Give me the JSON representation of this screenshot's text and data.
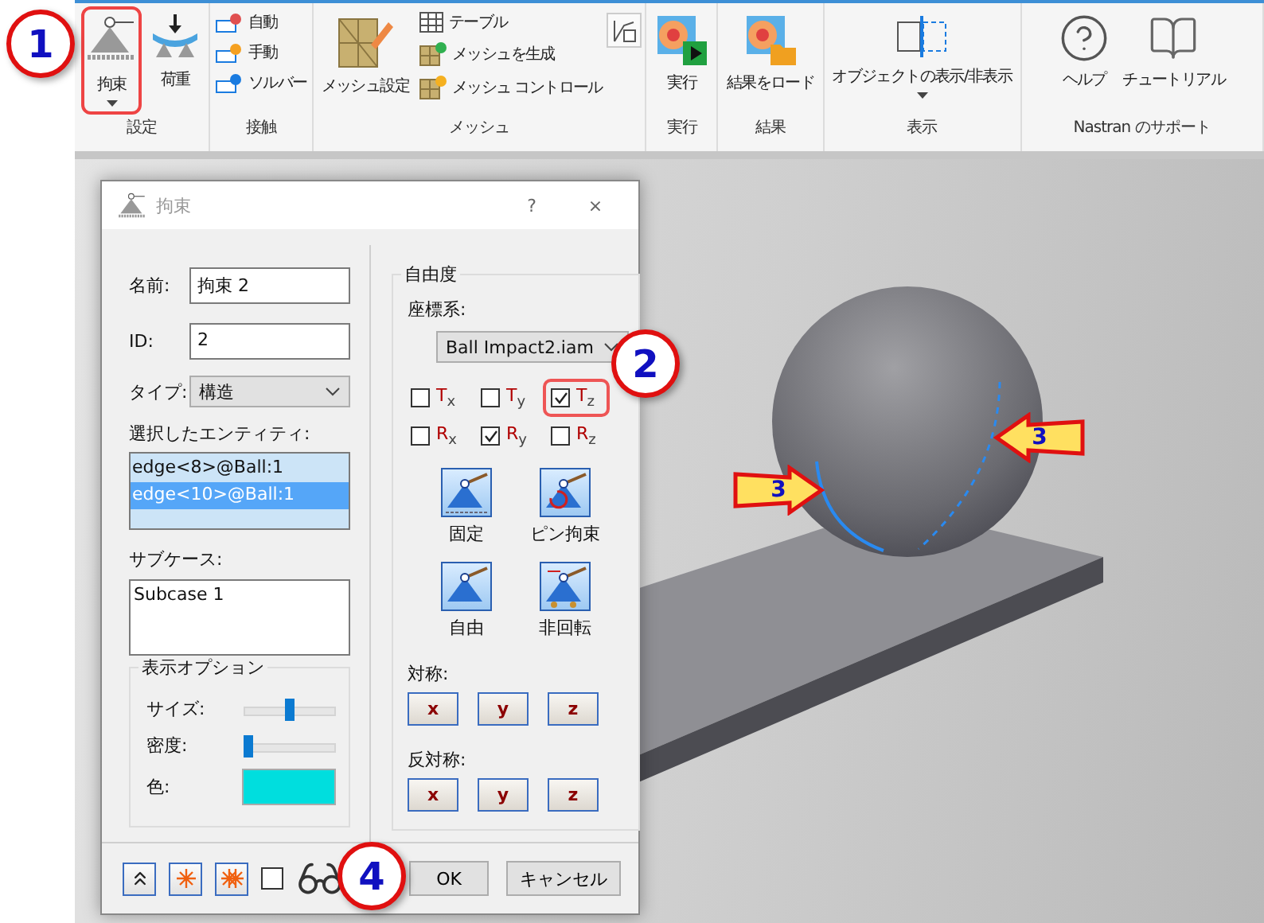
{
  "ribbon": {
    "groups": [
      {
        "label": "設定",
        "items": [
          {
            "kind": "large",
            "label": "拘束",
            "dropdown": true,
            "highlighted": true
          },
          {
            "kind": "large",
            "label": "荷重",
            "dropdown": false,
            "highlighted": false
          }
        ]
      },
      {
        "label": "接触",
        "items": [
          {
            "kind": "stack",
            "items": [
              {
                "label": "自動"
              },
              {
                "label": "手動"
              },
              {
                "label": "ソルバー"
              }
            ]
          }
        ]
      },
      {
        "label": "メッシュ",
        "items": [
          {
            "kind": "large",
            "label": "メッシュ設定",
            "dropdown": false,
            "highlighted": false
          },
          {
            "kind": "stack",
            "items": [
              {
                "label": "テーブル"
              },
              {
                "label": "メッシュを生成"
              },
              {
                "label": "メッシュ コントロール"
              }
            ]
          },
          {
            "kind": "icon"
          }
        ]
      },
      {
        "label": "実行",
        "items": [
          {
            "kind": "large",
            "label": "実行",
            "dropdown": false,
            "highlighted": false
          }
        ]
      },
      {
        "label": "結果",
        "items": [
          {
            "kind": "large",
            "label": "結果をロード",
            "dropdown": false,
            "highlighted": false
          }
        ]
      },
      {
        "label": "表示",
        "items": [
          {
            "kind": "large",
            "label": "オブジェクトの表示/非表示",
            "dropdown": true,
            "highlighted": false
          }
        ]
      },
      {
        "label": "Nastran のサポート",
        "items": [
          {
            "kind": "large",
            "label": "ヘルプ",
            "dropdown": false,
            "highlighted": false
          },
          {
            "kind": "large",
            "label": "チュートリアル",
            "dropdown": false,
            "highlighted": false
          }
        ]
      }
    ]
  },
  "dialog": {
    "title": "拘束",
    "help": "?",
    "close": "×",
    "name": {
      "label": "名前:",
      "value": "拘束 2"
    },
    "id": {
      "label": "ID:",
      "value": "2"
    },
    "type": {
      "label": "タイプ:",
      "value": "構造"
    },
    "entities": {
      "label": "選択したエンティティ:",
      "items": [
        {
          "text": "edge<8>@Ball:1",
          "selected": false
        },
        {
          "text": "edge<10>@Ball:1",
          "selected": true
        }
      ]
    },
    "subcase": {
      "label": "サブケース:",
      "value": "Subcase 1"
    },
    "display_options": {
      "title": "表示オプション",
      "size": {
        "label": "サイズ:",
        "level": 0.5
      },
      "density": {
        "label": "密度:",
        "level": 0
      },
      "color": {
        "label": "色:",
        "color": "#00dede"
      }
    },
    "dof": {
      "title": "自由度",
      "coord_label": "座標系:",
      "coord_value": "Ball Impact2.iam",
      "checks": [
        {
          "label": "T$_{x}$",
          "checked": false,
          "highlighted": false
        },
        {
          "label": "T$_{y}$",
          "checked": false,
          "highlighted": false
        },
        {
          "label": "T$_{z}$",
          "checked": true,
          "highlighted": true
        },
        {
          "label": "R$_{x}$",
          "checked": false,
          "highlighted": false
        },
        {
          "label": "R$_{y}$",
          "checked": true,
          "highlighted": false
        },
        {
          "label": "R$_{z}$",
          "checked": false,
          "highlighted": false
        }
      ],
      "presets": [
        {
          "label": "固定"
        },
        {
          "label": "ピン拘束"
        },
        {
          "label": "自由"
        },
        {
          "label": "非回転"
        }
      ],
      "symmetry": {
        "label": "対称:",
        "buttons": [
          "x",
          "y",
          "z"
        ]
      },
      "antisymmetry": {
        "label": "反対称:",
        "buttons": [
          "x",
          "y",
          "z"
        ]
      }
    },
    "footer": {
      "show_checked": false,
      "ok": "OK",
      "cancel": "キャンセル"
    }
  },
  "callouts": [
    {
      "number": "1"
    },
    {
      "number": "2"
    },
    {
      "number": "4"
    }
  ],
  "arrows": [
    {
      "number": "3"
    },
    {
      "number": "3"
    }
  ]
}
